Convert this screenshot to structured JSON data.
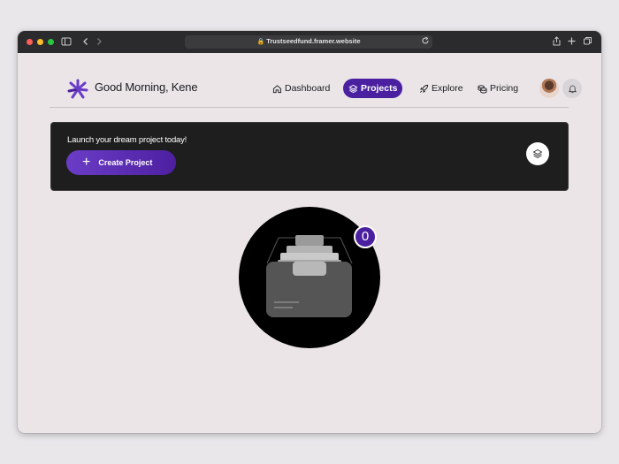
{
  "browser": {
    "url": "Trustseedfund.framer.website"
  },
  "header": {
    "greeting": "Good Morning, Kene",
    "nav": [
      {
        "label": "Dashboard",
        "icon": "home-icon",
        "active": false
      },
      {
        "label": "Projects",
        "icon": "layers-icon",
        "active": true
      },
      {
        "label": "Explore",
        "icon": "rocket-icon",
        "active": false
      },
      {
        "label": "Pricing",
        "icon": "coins-icon",
        "active": false
      }
    ]
  },
  "banner": {
    "text": "Launch your dream project today!",
    "create_label": "Create Project"
  },
  "empty_state": {
    "count": "0"
  },
  "colors": {
    "accent": "#4a1fa0",
    "banner_bg": "#1e1e1e",
    "page_bg": "#ebe5e8"
  }
}
